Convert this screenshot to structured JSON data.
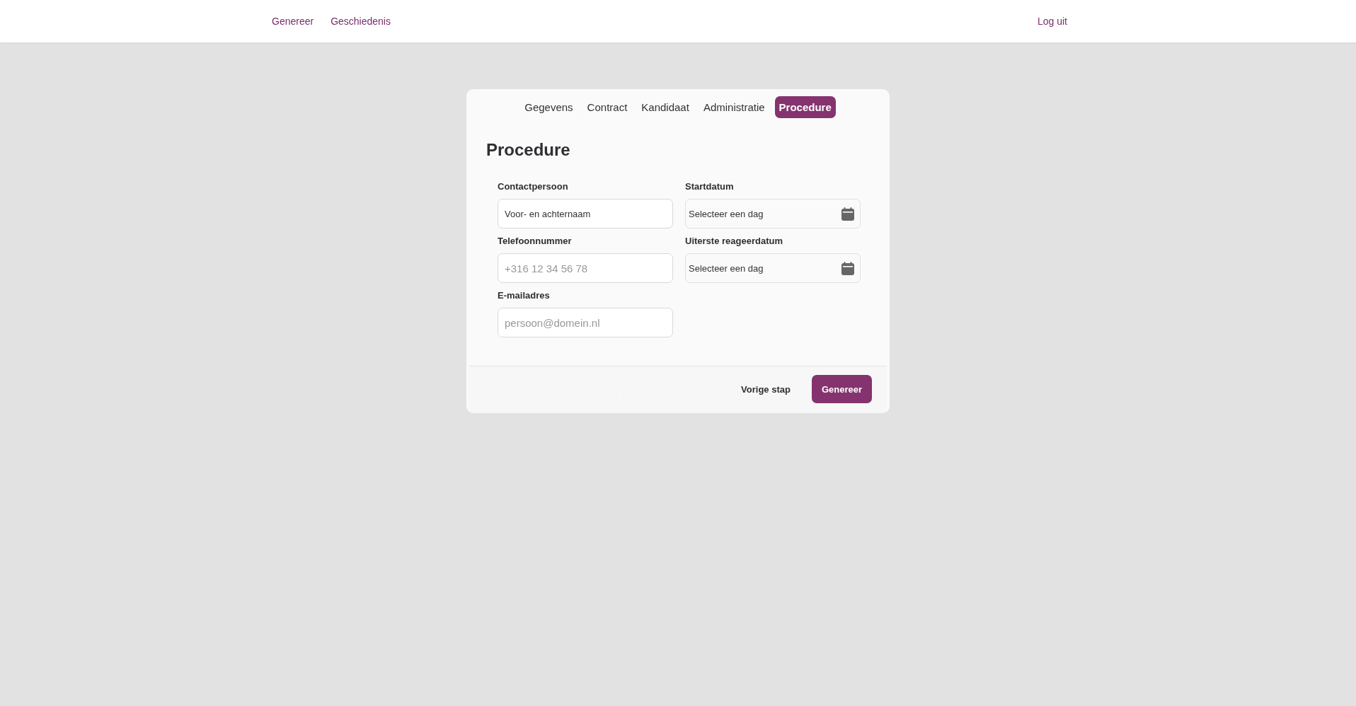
{
  "nav": {
    "links": [
      {
        "label": "Genereer"
      },
      {
        "label": "Geschiedenis"
      }
    ],
    "logout": "Log uit"
  },
  "tabs": [
    {
      "label": "Gegevens",
      "selected": false
    },
    {
      "label": "Contract",
      "selected": false
    },
    {
      "label": "Kandidaat",
      "selected": false
    },
    {
      "label": "Administratie",
      "selected": false
    },
    {
      "label": "Procedure",
      "selected": true
    }
  ],
  "form": {
    "title": "Procedure",
    "fields": [
      {
        "kind": "text",
        "label": "Contactpersoon",
        "value": "Voor- en achternaam"
      },
      {
        "kind": "date",
        "label": "Startdatum",
        "value": "Selecteer een dag"
      },
      {
        "kind": "text",
        "label": "Telefoonnummer",
        "placeholder": "+316 12 34 56 78"
      },
      {
        "kind": "date",
        "label": "Uiterste reageerdatum",
        "value": "Selecteer een dag"
      },
      {
        "kind": "text",
        "label": "E-mailadres",
        "placeholder": "persoon@domein.nl"
      }
    ]
  },
  "footer": {
    "buttons": [
      {
        "kind": "secondary",
        "label": "Vorige stap"
      },
      {
        "kind": "primary",
        "label": "Genereer"
      }
    ]
  }
}
